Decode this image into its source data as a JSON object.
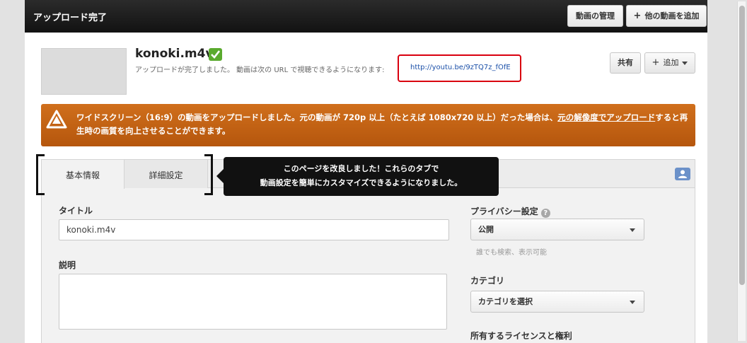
{
  "header": {
    "title": "アップロード完了",
    "manage_label": "動画の管理",
    "add_video_label": "他の動画を追加"
  },
  "video": {
    "filename": "konoki.m4v",
    "notice": "アップロードが完了しました。 動画は次の URL で視聴できるようになります:",
    "url": "http://youtu.be/9zTQ7z_fOfE",
    "share_label": "共有",
    "add_label": "追加"
  },
  "warning": {
    "text_before": "ワイドスクリーン（16:9）の動画をアップロードしました。元の動画が 720p 以上（たとえば 1080x720 以上）だった場合は、",
    "link_text": "元の解像度でアップロード",
    "text_after": "すると再生時の画質を向上させることができます。"
  },
  "tabs": {
    "basic": "基本情報",
    "advanced": "詳細設定"
  },
  "tooltip": {
    "line1": "このページを改良しました！これらのタブで",
    "line2": "動画設定を簡単にカスタマイズできるようになりました。"
  },
  "form": {
    "title_label": "タイトル",
    "title_value": "konoki.m4v",
    "description_label": "説明",
    "description_value": "",
    "privacy_label": "プライバシー設定",
    "privacy_value": "公開",
    "privacy_hint": "誰でも検索、表示可能",
    "category_label": "カテゴリ",
    "category_value": "カテゴリを選択",
    "license_label": "所有するライセンスと権利"
  },
  "colors": {
    "accent_red": "#d9000f",
    "warning_orange": "#c7641a",
    "check_green": "#5aaa2e",
    "link_blue": "#1a4fa8"
  },
  "icons": [
    "check-icon",
    "plus-icon",
    "chevron-down-icon",
    "warning-icon",
    "person-icon",
    "help-icon"
  ]
}
